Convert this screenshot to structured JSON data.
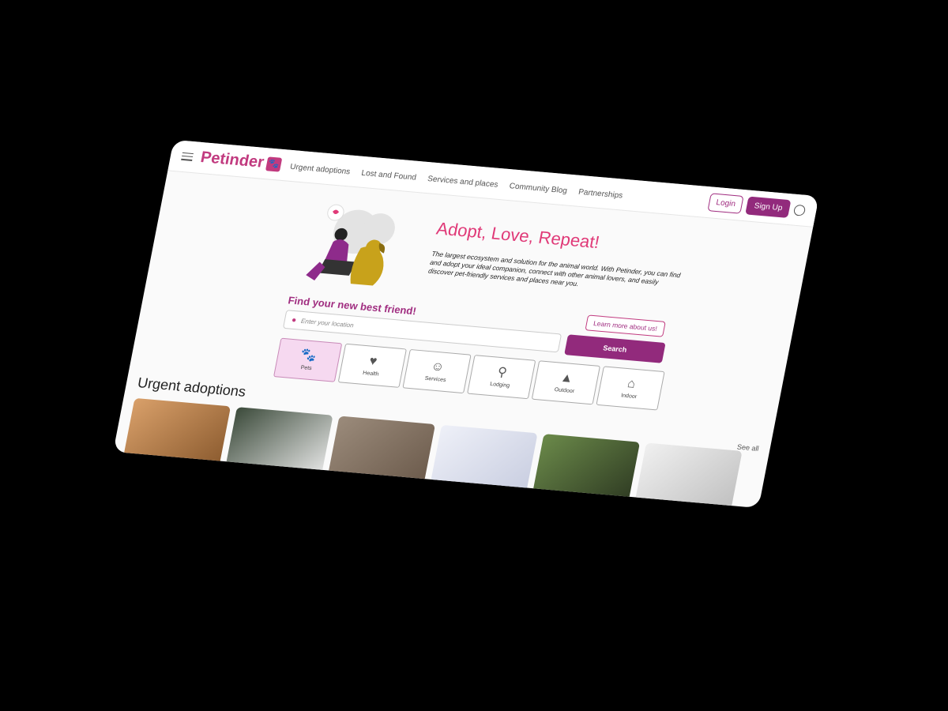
{
  "app": {
    "name": "Petinder"
  },
  "nav": {
    "items": [
      "Urgent adoptions",
      "Lost and Found",
      "Services and places",
      "Community Blog",
      "Partnerships"
    ]
  },
  "auth": {
    "login_label": "Login",
    "signup_label": "Sign Up"
  },
  "hero": {
    "title": "Adopt, Love, Repeat!",
    "text": "The largest ecosystem and solution for the animal world. With Petinder, you can find and adopt your ideal companion, connect with other animal lovers, and easily discover pet-friendly services and places near you.",
    "learn_more_label": "Learn more about us!"
  },
  "search": {
    "title": "Find your new best friend!",
    "placeholder": "Enter your location",
    "button_label": "Search"
  },
  "categories": [
    {
      "label": "Pets",
      "icon": "paw-icon",
      "active": true
    },
    {
      "label": "Health",
      "icon": "heart-pulse-icon",
      "active": false
    },
    {
      "label": "Services",
      "icon": "people-icon",
      "active": false
    },
    {
      "label": "Lodging",
      "icon": "map-pin-icon",
      "active": false
    },
    {
      "label": "Outdoor",
      "icon": "tree-icon",
      "active": false
    },
    {
      "label": "Indoor",
      "icon": "house-heart-icon",
      "active": false
    }
  ],
  "urgent": {
    "title": "Urgent adoptions",
    "see_all_label": "See all"
  },
  "colors": {
    "brand": "#c13a7f",
    "primary": "#922a7c",
    "accent_title": "#e03a78"
  }
}
